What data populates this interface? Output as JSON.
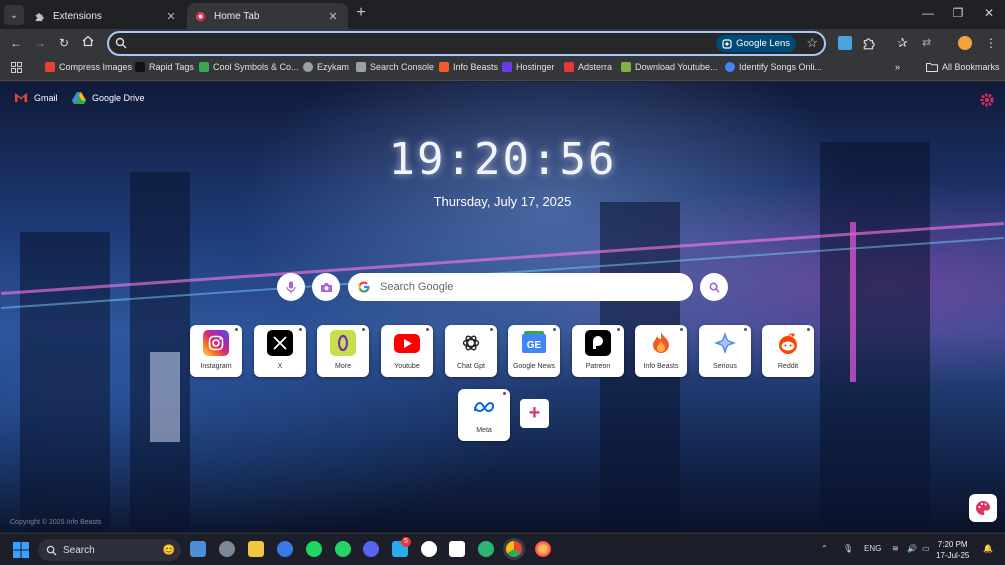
{
  "tabs": [
    {
      "title": "Extensions",
      "active": false
    },
    {
      "title": "Home Tab",
      "active": true
    }
  ],
  "toolbar": {
    "address_value": "",
    "lens_label": "Google Lens"
  },
  "bookmarks": {
    "items": [
      {
        "label": "Compress Images",
        "color": "#e94235"
      },
      {
        "label": "Rapid Tags",
        "color": "#111111"
      },
      {
        "label": "Cool Symbols & Co...",
        "color": "#34a853"
      },
      {
        "label": "Ezykam",
        "color": "#9aa0a6"
      },
      {
        "label": "Search Console",
        "color": "#9aa0a6"
      },
      {
        "label": "Info Beasts",
        "color": "#f25c2a"
      },
      {
        "label": "Hostinger",
        "color": "#673de6"
      },
      {
        "label": "Adsterra",
        "color": "#e53935"
      },
      {
        "label": "Download Youtube...",
        "color": "#7cb342"
      },
      {
        "label": "Identify Songs Onli...",
        "color": "#4285f4"
      }
    ],
    "all_bookmarks": "All Bookmarks"
  },
  "page": {
    "links": [
      {
        "label": "Gmail"
      },
      {
        "label": "Google Drive"
      }
    ],
    "time": "19:20:56",
    "date": "Thursday, July 17, 2025",
    "search_placeholder": "Search Google",
    "tiles": [
      {
        "label": "Instagram",
        "icon": "instagram-icon",
        "color": "#d62976"
      },
      {
        "label": "X",
        "icon": "x-icon",
        "color": "#000000"
      },
      {
        "label": "More",
        "icon": "more-icon",
        "color": "#9ad13b"
      },
      {
        "label": "Youtube",
        "icon": "youtube-icon",
        "color": "#ff0000"
      },
      {
        "label": "Chat Gpt",
        "icon": "chatgpt-icon",
        "color": "#ffffff"
      },
      {
        "label": "Google News",
        "icon": "google-news-icon",
        "color": "#4285f4"
      },
      {
        "label": "Patreon",
        "icon": "patreon-icon",
        "color": "#000000"
      },
      {
        "label": "Info Beasts",
        "icon": "info-beasts-icon",
        "color": "#f25c2a"
      },
      {
        "label": "Serious",
        "icon": "serious-icon",
        "color": "#5b8def"
      },
      {
        "label": "Reddit",
        "icon": "reddit-icon",
        "color": "#ff4500"
      },
      {
        "label": "Meta",
        "icon": "meta-icon",
        "color": "#0668e1"
      }
    ],
    "add_label": "+",
    "copyright": "Copyright © 2025 Info Beasts"
  },
  "taskbar": {
    "search_label": "Search",
    "notification_badge": "5",
    "language": "ENG",
    "time": "7:20 PM",
    "date": "17-Jul-25"
  }
}
